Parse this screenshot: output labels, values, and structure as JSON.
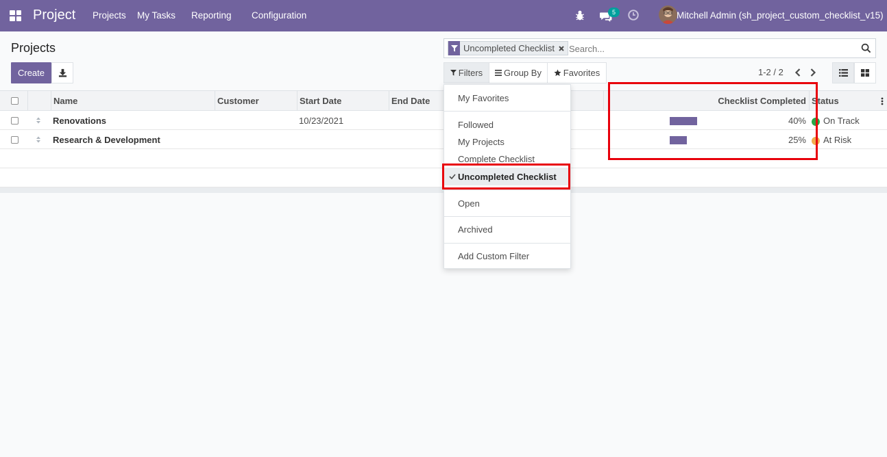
{
  "navbar": {
    "app_name": "Project",
    "menu": [
      "Projects",
      "My Tasks",
      "Reporting",
      "Configuration"
    ],
    "message_count": "5",
    "user": "Mitchell Admin (sh_project_custom_checklist_v15)",
    "icons": [
      "apps-icon",
      "bug-icon",
      "chat-icon",
      "clock-icon"
    ]
  },
  "page": {
    "title": "Projects",
    "create_label": "Create"
  },
  "search": {
    "facet": "Uncompleted Checklist",
    "placeholder": "Search..."
  },
  "filters_bar": {
    "filters": "Filters",
    "group_by": "Group By",
    "favorites": "Favorites"
  },
  "pager": {
    "text": "1-2 / 2"
  },
  "table": {
    "columns": [
      "Name",
      "Customer",
      "Start Date",
      "End Date",
      "Checklist Completed",
      "Status"
    ],
    "rows": [
      {
        "name": "Renovations",
        "customer": "",
        "start_date": "10/23/2021",
        "end_date": "",
        "checklist_pct": 40,
        "checklist_label": "40%",
        "status": "On Track",
        "status_color": "#28a745"
      },
      {
        "name": "Research & Development",
        "customer": "",
        "start_date": "",
        "end_date": "",
        "checklist_pct": 25,
        "checklist_label": "25%",
        "status": "At Risk",
        "status_color": "#f0ad4e"
      }
    ]
  },
  "dropdown": {
    "items": [
      "My Favorites",
      "Followed",
      "My Projects",
      "Complete Checklist",
      "Uncompleted Checklist",
      "Open",
      "Archived",
      "Add Custom Filter"
    ],
    "selected": "Uncompleted Checklist"
  },
  "colors": {
    "brand": "#71639e",
    "highlight": "#e8000b"
  }
}
